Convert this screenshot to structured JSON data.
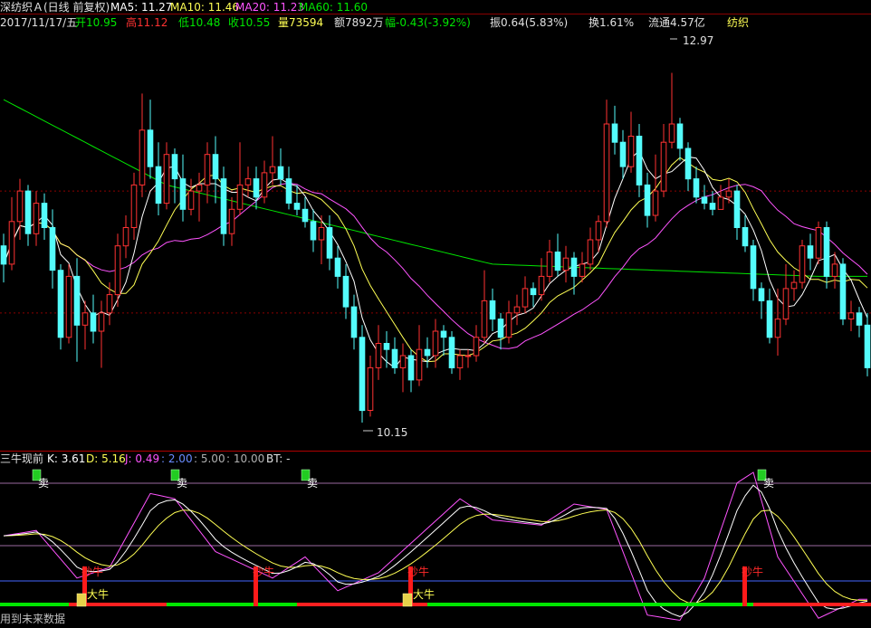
{
  "main_header": {
    "stock": "深纺织Ａ(日线 前复权)",
    "ma5": "MA5: 11.27",
    "ma10": "MA10: 11.46",
    "ma20": "MA20: 11.23",
    "ma60": "MA60: 11.60"
  },
  "info_bar": {
    "date": "2017/11/17/五",
    "open": "开10.95",
    "high": "高11.12",
    "low": "低10.48",
    "close": "收10.55",
    "volume": "量73594",
    "amount": "额7892万",
    "change": "幅-0.43(-3.92%)",
    "amplitude": "振0.64(5.83%)",
    "turnover": "换1.61%",
    "float_cap": "流通4.57亿",
    "industry": "纺织"
  },
  "main_annotations": {
    "high_label": "12.97",
    "low_label": "10.15"
  },
  "sub_header": {
    "name": "三牛现前",
    "k": "K: 3.61",
    "d": "D: 5.16",
    "j": "J: 0.49",
    "l1": ": 2.00",
    "l2": ": 5.00",
    "l3": ": 10.00",
    "bt": "BT: -"
  },
  "signals": {
    "sell": "卖",
    "buy": "抄牛",
    "bull": "大牛"
  },
  "footer": {
    "text": "用到未来数据"
  },
  "colors": {
    "up": "#ff3232",
    "down": "#54fcfc",
    "ma5": "#ffffff",
    "ma10": "#ffff54",
    "ma20": "#ff54ff",
    "ma60": "#00e600",
    "grid": "#8b0000"
  },
  "chart_data": [
    {
      "type": "candlestick",
      "ylim": [
        9.9,
        13.3
      ],
      "high_marker": 12.97,
      "low_marker": 10.15,
      "ohlc": [
        [
          11.55,
          11.4,
          11.65,
          11.25
        ],
        [
          11.4,
          11.75,
          11.95,
          11.35
        ],
        [
          11.75,
          12.0,
          12.1,
          11.6
        ],
        [
          12.0,
          11.65,
          12.05,
          11.55
        ],
        [
          11.65,
          11.9,
          12.0,
          11.55
        ],
        [
          11.9,
          11.7,
          11.98,
          11.6
        ],
        [
          11.7,
          11.35,
          11.85,
          11.2
        ],
        [
          11.35,
          10.8,
          11.4,
          10.7
        ],
        [
          10.8,
          11.3,
          11.4,
          10.75
        ],
        [
          11.3,
          10.9,
          11.45,
          10.6
        ],
        [
          10.9,
          11.0,
          11.1,
          10.7
        ],
        [
          11.0,
          10.85,
          11.15,
          10.75
        ],
        [
          10.85,
          11.0,
          11.1,
          10.55
        ],
        [
          11.0,
          11.15,
          11.25,
          10.9
        ],
        [
          11.15,
          11.55,
          11.65,
          11.05
        ],
        [
          11.55,
          11.7,
          11.8,
          11.45
        ],
        [
          11.7,
          12.05,
          12.15,
          11.6
        ],
        [
          12.05,
          12.5,
          12.8,
          11.95
        ],
        [
          12.5,
          12.2,
          12.75,
          12.1
        ],
        [
          12.2,
          11.9,
          12.4,
          11.8
        ],
        [
          11.9,
          12.3,
          12.4,
          11.85
        ],
        [
          12.3,
          12.1,
          12.35,
          11.9
        ],
        [
          12.1,
          11.85,
          12.3,
          11.75
        ],
        [
          11.85,
          12.0,
          12.1,
          11.8
        ],
        [
          12.0,
          12.05,
          12.15,
          11.75
        ],
        [
          12.05,
          12.3,
          12.4,
          11.9
        ],
        [
          12.3,
          12.1,
          12.45,
          11.9
        ],
        [
          12.1,
          11.65,
          12.2,
          11.55
        ],
        [
          11.65,
          11.85,
          11.95,
          11.55
        ],
        [
          11.85,
          12.05,
          12.4,
          11.8
        ],
        [
          12.05,
          12.1,
          12.2,
          11.95
        ],
        [
          12.1,
          11.95,
          12.2,
          11.85
        ],
        [
          11.95,
          12.15,
          12.25,
          11.9
        ],
        [
          12.15,
          12.2,
          12.45,
          12.05
        ],
        [
          12.2,
          12.1,
          12.35,
          12.05
        ],
        [
          12.1,
          11.9,
          12.2,
          11.85
        ],
        [
          11.9,
          11.85,
          12.05,
          11.8
        ],
        [
          11.85,
          11.75,
          11.95,
          11.7
        ],
        [
          11.75,
          11.6,
          11.85,
          11.5
        ],
        [
          11.6,
          11.7,
          11.8,
          11.4
        ],
        [
          11.7,
          11.45,
          11.8,
          11.35
        ],
        [
          11.45,
          11.3,
          11.55,
          11.2
        ],
        [
          11.3,
          11.05,
          11.4,
          10.95
        ],
        [
          11.05,
          10.8,
          11.15,
          10.7
        ],
        [
          10.8,
          10.2,
          10.9,
          10.1
        ],
        [
          10.2,
          10.55,
          10.65,
          10.15
        ],
        [
          10.55,
          10.75,
          10.9,
          10.45
        ],
        [
          10.75,
          10.7,
          10.85,
          10.55
        ],
        [
          10.7,
          10.55,
          10.8,
          10.5
        ],
        [
          10.55,
          10.65,
          10.75,
          10.35
        ],
        [
          10.65,
          10.45,
          10.7,
          10.35
        ],
        [
          10.45,
          10.7,
          10.9,
          10.4
        ],
        [
          10.7,
          10.65,
          10.8,
          10.55
        ],
        [
          10.65,
          10.85,
          10.95,
          10.55
        ],
        [
          10.85,
          10.8,
          10.9,
          10.65
        ],
        [
          10.8,
          10.55,
          10.85,
          10.5
        ],
        [
          10.55,
          10.65,
          10.7,
          10.45
        ],
        [
          10.65,
          10.65,
          10.7,
          10.55
        ],
        [
          10.65,
          10.8,
          10.9,
          10.6
        ],
        [
          10.8,
          11.1,
          11.35,
          10.75
        ],
        [
          11.1,
          10.95,
          11.2,
          10.85
        ],
        [
          10.95,
          10.8,
          11.0,
          10.7
        ],
        [
          10.8,
          11.0,
          11.1,
          10.75
        ],
        [
          11.0,
          11.05,
          11.15,
          10.9
        ],
        [
          11.05,
          11.2,
          11.3,
          11.0
        ],
        [
          11.2,
          11.15,
          11.25,
          11.05
        ],
        [
          11.15,
          11.3,
          11.45,
          11.1
        ],
        [
          11.3,
          11.5,
          11.6,
          11.25
        ],
        [
          11.5,
          11.35,
          11.65,
          11.3
        ],
        [
          11.35,
          11.45,
          11.55,
          11.25
        ],
        [
          11.45,
          11.3,
          11.5,
          11.15
        ],
        [
          11.3,
          11.4,
          11.5,
          11.25
        ],
        [
          11.4,
          11.6,
          11.7,
          11.35
        ],
        [
          11.6,
          11.75,
          11.8,
          11.5
        ],
        [
          11.75,
          12.55,
          12.75,
          11.7
        ],
        [
          12.55,
          12.4,
          12.7,
          12.3
        ],
        [
          12.4,
          12.2,
          12.5,
          12.1
        ],
        [
          12.2,
          12.45,
          12.65,
          12.15
        ],
        [
          12.45,
          12.05,
          12.55,
          11.95
        ],
        [
          12.05,
          11.8,
          12.15,
          11.7
        ],
        [
          11.8,
          12.0,
          12.3,
          11.75
        ],
        [
          12.0,
          12.4,
          12.55,
          11.95
        ],
        [
          12.4,
          12.55,
          12.97,
          12.35
        ],
        [
          12.55,
          12.35,
          12.6,
          12.25
        ],
        [
          12.35,
          12.1,
          12.4,
          12.0
        ],
        [
          12.1,
          11.95,
          12.2,
          11.9
        ],
        [
          11.95,
          11.9,
          12.05,
          11.85
        ],
        [
          11.9,
          11.85,
          12.0,
          11.8
        ],
        [
          11.85,
          11.95,
          12.05,
          11.85
        ],
        [
          11.95,
          12.0,
          12.1,
          11.9
        ],
        [
          12.0,
          11.7,
          12.05,
          11.6
        ],
        [
          11.7,
          11.55,
          11.8,
          11.5
        ],
        [
          11.55,
          11.2,
          11.6,
          11.1
        ],
        [
          11.2,
          11.1,
          11.25,
          10.95
        ],
        [
          11.1,
          10.8,
          11.2,
          10.75
        ],
        [
          10.8,
          10.95,
          11.2,
          10.65
        ],
        [
          10.95,
          11.2,
          11.4,
          10.9
        ],
        [
          11.2,
          11.25,
          11.35,
          11.1
        ],
        [
          11.25,
          11.55,
          11.6,
          11.2
        ],
        [
          11.55,
          11.45,
          11.65,
          11.35
        ],
        [
          11.45,
          11.7,
          11.75,
          11.4
        ],
        [
          11.7,
          11.3,
          11.75,
          11.2
        ],
        [
          11.3,
          11.4,
          11.5,
          11.2
        ],
        [
          11.4,
          10.95,
          11.45,
          10.9
        ],
        [
          10.95,
          11.0,
          11.1,
          10.85
        ],
        [
          11.0,
          10.9,
          11.05,
          10.8
        ],
        [
          10.9,
          10.55,
          11.0,
          10.48
        ]
      ],
      "ma60_anchors": [
        [
          0,
          12.75
        ],
        [
          20,
          12.05
        ],
        [
          60,
          11.4
        ],
        [
          100,
          11.3
        ]
      ]
    },
    {
      "type": "line",
      "series_names": [
        "K",
        "D",
        "J"
      ],
      "ylim": [
        -5,
        120
      ],
      "levels": [
        2,
        5,
        10
      ],
      "j_anchors": [
        [
          0,
          60
        ],
        [
          4,
          65
        ],
        [
          9,
          20
        ],
        [
          13,
          30
        ],
        [
          18,
          100
        ],
        [
          21,
          95
        ],
        [
          26,
          45
        ],
        [
          33,
          20
        ],
        [
          37,
          40
        ],
        [
          41,
          8
        ],
        [
          46,
          25
        ],
        [
          56,
          95
        ],
        [
          60,
          75
        ],
        [
          66,
          70
        ],
        [
          70,
          90
        ],
        [
          74,
          85
        ],
        [
          79,
          -15
        ],
        [
          83,
          -20
        ],
        [
          86,
          20
        ],
        [
          90,
          110
        ],
        [
          92,
          120
        ],
        [
          95,
          40
        ],
        [
          100,
          -18
        ],
        [
          105,
          0
        ]
      ],
      "sell_indices": [
        4,
        21,
        37,
        93
      ],
      "buy_indices": [
        10,
        31,
        50,
        91,
        107
      ],
      "bull_indices": [
        10,
        50
      ],
      "bar_segments": [
        [
          0,
          8,
          "#00e600"
        ],
        [
          8,
          20,
          "#ff2020"
        ],
        [
          20,
          36,
          "#00e600"
        ],
        [
          36,
          52,
          "#ff2020"
        ],
        [
          52,
          92,
          "#00e600"
        ],
        [
          92,
          113,
          "#ff2020"
        ],
        [
          113,
          120,
          "#00e600"
        ]
      ]
    }
  ]
}
